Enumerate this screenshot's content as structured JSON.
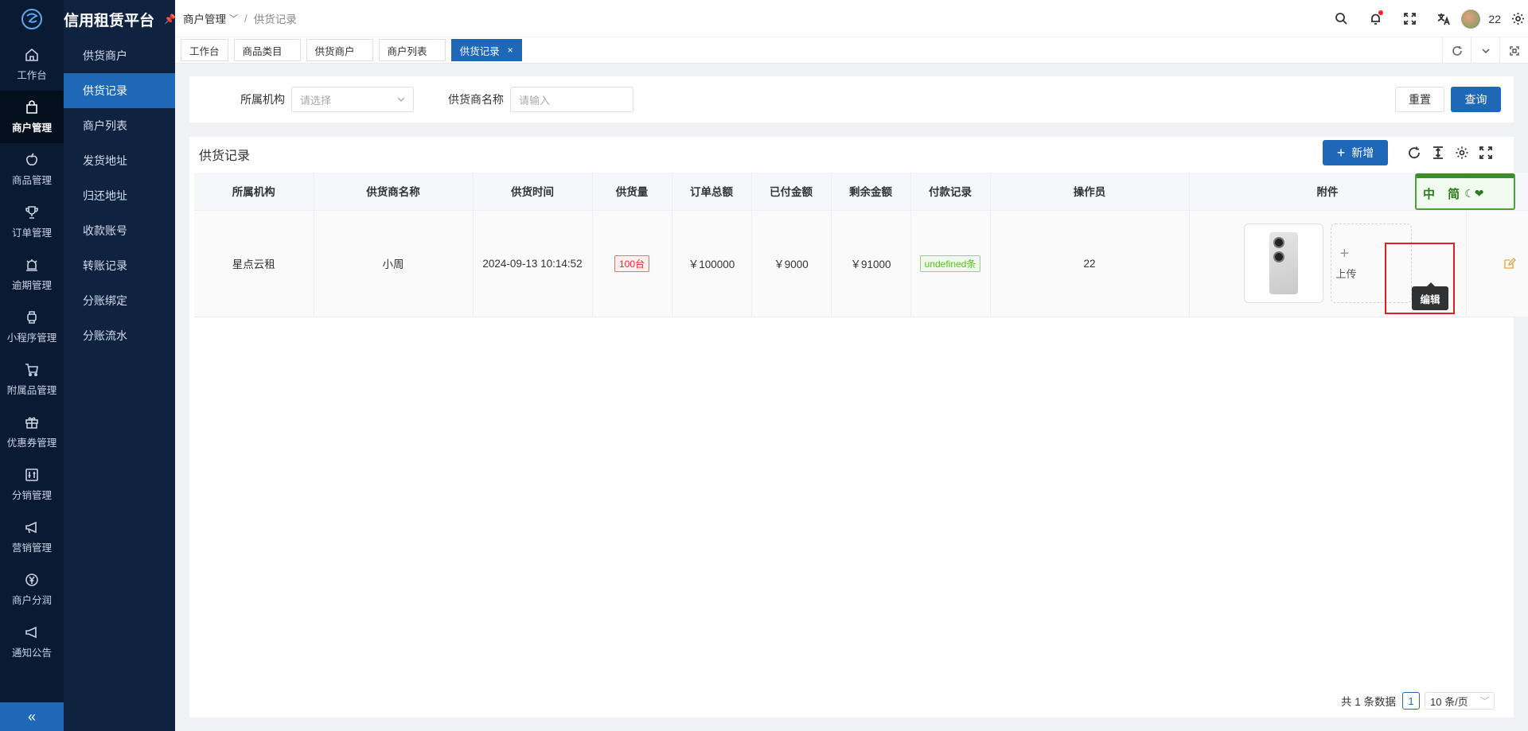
{
  "app": {
    "title": "信用租赁平台"
  },
  "rail": [
    {
      "label": "工作台",
      "icon": "home-icon"
    },
    {
      "label": "商户管理",
      "icon": "shopping-bag-icon",
      "active": true
    },
    {
      "label": "商品管理",
      "icon": "apple-icon"
    },
    {
      "label": "订单管理",
      "icon": "trophy-icon"
    },
    {
      "label": "逾期管理",
      "icon": "alarm-icon"
    },
    {
      "label": "小程序管理",
      "icon": "watch-icon"
    },
    {
      "label": "附属品管理",
      "icon": "cart-icon"
    },
    {
      "label": "优惠券管理",
      "icon": "gift-icon"
    },
    {
      "label": "分销管理",
      "icon": "sliders-icon"
    },
    {
      "label": "营销管理",
      "icon": "megaphone-icon"
    },
    {
      "label": "商户分润",
      "icon": "yen-icon"
    },
    {
      "label": "通知公告",
      "icon": "notice-icon"
    }
  ],
  "submenu": [
    "供货商户",
    "供货记录",
    "商户列表",
    "发货地址",
    "归还地址",
    "收款账号",
    "转账记录",
    "分账绑定",
    "分账流水"
  ],
  "breadcrumb": {
    "parent": "商户管理",
    "current": "供货记录"
  },
  "user": {
    "name": "22"
  },
  "tabs": [
    "工作台",
    "商品类目",
    "供货商户",
    "商户列表",
    "供货记录"
  ],
  "filters": {
    "org_label": "所属机构",
    "org_placeholder": "请选择",
    "supplier_label": "供货商名称",
    "supplier_placeholder": "请输入",
    "reset": "重置",
    "query": "查询"
  },
  "card": {
    "title": "供货记录",
    "add": "新增"
  },
  "table": {
    "headers": [
      "所属机构",
      "供货商名称",
      "供货时间",
      "供货量",
      "订单总额",
      "已付金额",
      "剩余金额",
      "付款记录",
      "操作员",
      "附件"
    ],
    "rows": [
      {
        "org": "星点云租",
        "supplier": "小周",
        "time": "2024-09-13 10:14:52",
        "qty": "100台",
        "total": "￥100000",
        "paid": "￥9000",
        "remain": "￥91000",
        "payment": "undefined条",
        "operator": "22",
        "upload": "上传"
      }
    ]
  },
  "tooltip": {
    "edit": "编辑"
  },
  "ime": {
    "text": "中 简"
  },
  "pager": {
    "total": "共 1 条数据",
    "page": "1",
    "size": "10 条/页"
  },
  "colors": {
    "primary": "#1f68b8",
    "sidebar": "#0a1a33",
    "red": "#f5222d",
    "green": "#389e0d",
    "blue": "#2233cc"
  }
}
